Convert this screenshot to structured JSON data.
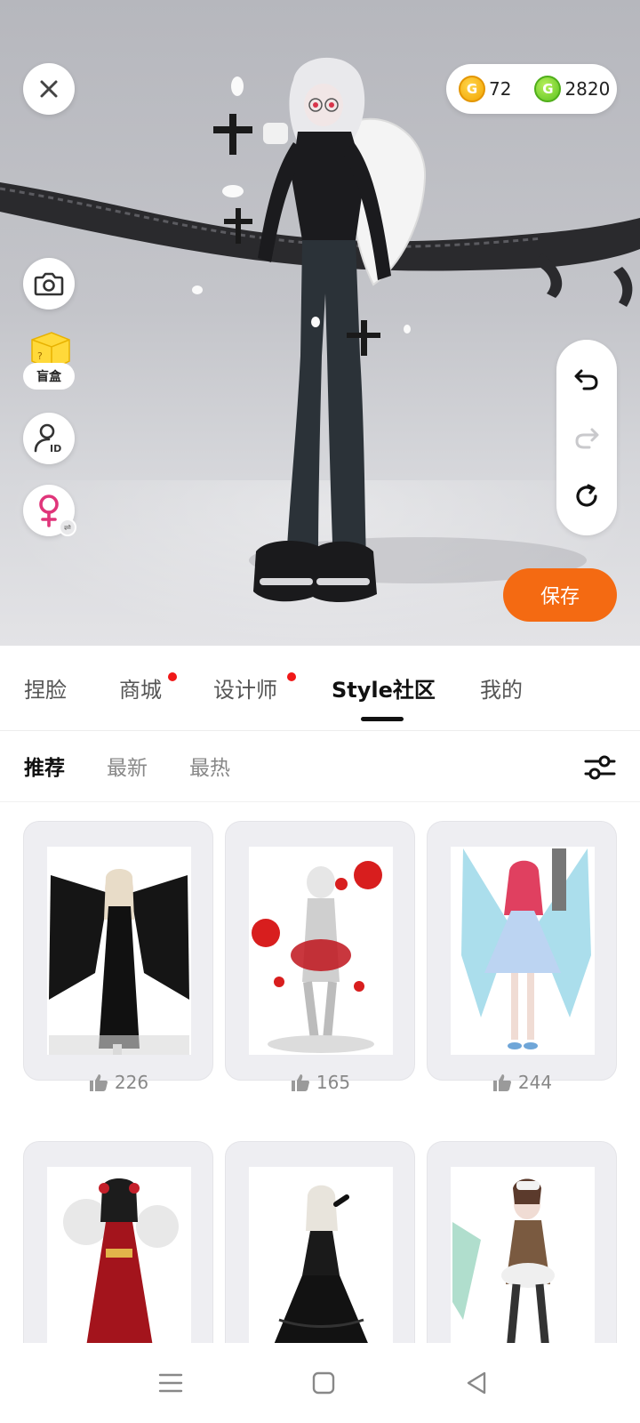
{
  "preview": {
    "blindbox_label": "盲盒",
    "save_label": "保存",
    "currency": {
      "gold_coin_value": "72",
      "green_coin_value": "2820",
      "gold_coin_symbol": "G",
      "green_coin_symbol": "G"
    },
    "icons": [
      "close-icon",
      "camera-icon",
      "avatar-id-icon",
      "female-gender-icon",
      "undo-icon",
      "redo-icon",
      "reset-icon"
    ]
  },
  "main_tabs": [
    {
      "label": "捏脸",
      "active": false,
      "badge": false
    },
    {
      "label": "商城",
      "active": false,
      "badge": true
    },
    {
      "label": "设计师",
      "active": false,
      "badge": true
    },
    {
      "label": "Style社区",
      "active": true,
      "badge": false
    },
    {
      "label": "我的",
      "active": false,
      "badge": false
    }
  ],
  "sub_tabs": [
    {
      "label": "推荐",
      "active": true
    },
    {
      "label": "最新",
      "active": false
    },
    {
      "label": "最热",
      "active": false
    }
  ],
  "cards": [
    {
      "likes": "226"
    },
    {
      "likes": "165"
    },
    {
      "likes": "244"
    },
    {
      "likes": ""
    },
    {
      "likes": ""
    },
    {
      "likes": ""
    }
  ],
  "colors": {
    "accent": "#f46a12",
    "badge": "#f01818",
    "gold_coin": "#f2a400",
    "green_coin": "#5cc220",
    "gender_icon": "#e0357a"
  }
}
